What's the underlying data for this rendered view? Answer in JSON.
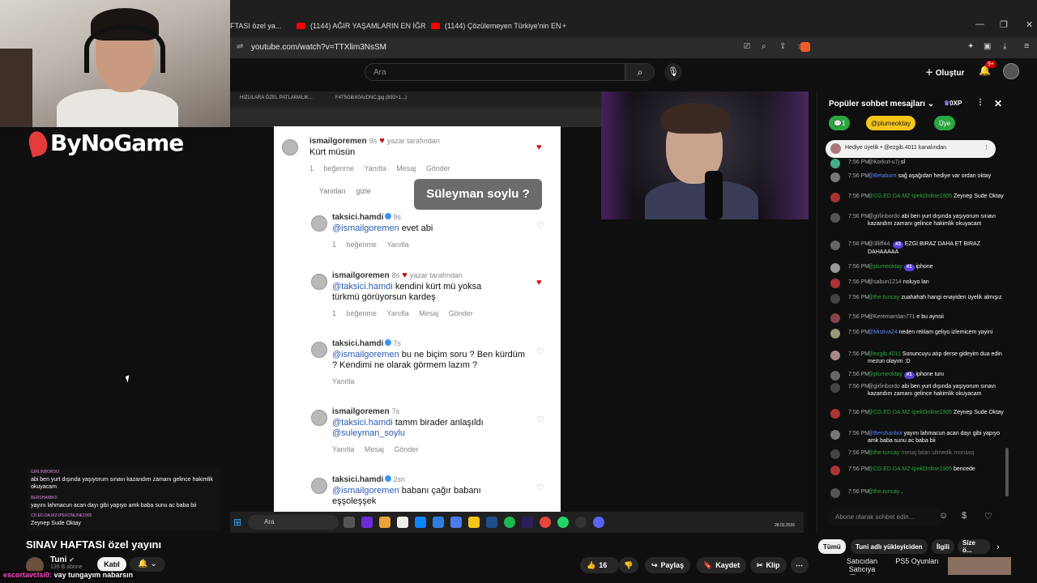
{
  "browser": {
    "tabs": [
      {
        "label": "FTASI özel ya..."
      },
      {
        "label": "(1144) AĞIR YAŞAMLARIN EN İĞREN..."
      },
      {
        "label": "(1144) Çözülemeyen Türkiye'nin EN..."
      }
    ],
    "new_tab": "+",
    "url": "youtube.com/watch?v=TTXlim3NsSM"
  },
  "yt_header": {
    "search_placeholder": "Ara",
    "create_label": "Oluştur",
    "notification_count": "9+"
  },
  "logo": {
    "text": "ByNoGame"
  },
  "inner_browser": {
    "tabs": [
      "HIZLILARA ÖZEL PATLAMALIK...",
      "F4T5GibX0AcDNC.jpg (892×1...)"
    ]
  },
  "phone": {
    "question_overlay": "Süleyman soylu ?",
    "comments": [
      {
        "user": "ismailgoremen",
        "time": "9s",
        "author_tag": "yazar tarafından",
        "body": "Kürt müsün",
        "actions": "1 beğenme   Yanıtla   Mesaj Gönder",
        "hide_replies": "Yanıtları gizle"
      },
      {
        "user": "taksici.hamdi",
        "time": "9s",
        "mention": "@ismailgoremen",
        "body": "evet abi",
        "actions": "1 beğenme   Yanıtla"
      },
      {
        "user": "ismailgoremen",
        "time": "8s",
        "author_tag": "yazar tarafından",
        "mention": "@taksici.hamdi",
        "body": "kendini kürt mü yoksa türkmü  görüyorsun kardeş",
        "actions": "1 beğenme   Yanıtla   Mesaj Gönder"
      },
      {
        "user": "taksici.hamdi",
        "time": "7s",
        "mention": "@ismailgoremen",
        "body": "bu ne biçim soru ? Ben kürdüm ? Kendimi ne olarak görmem lazım ?",
        "actions": "Yanıtla"
      },
      {
        "user": "ismailgoremen",
        "time": "7s",
        "mention": "@taksici.hamdi",
        "body": "tamm birader anlaşıldı",
        "mention2": "@suleyman_soylu",
        "actions": "Yanıtla   Mesaj Gönder"
      },
      {
        "user": "taksici.hamdi",
        "time": "2sn",
        "mention": "@ismailgoremen",
        "body": "babanı çağır babanı eşşoleşşek"
      }
    ]
  },
  "overlay_chat": [
    {
      "name": "GIRLINBORDO",
      "text": "abi ben yurt dışında yaşıyorum sınavı kazandım zamanı gelince hakimlik okuyacam"
    },
    {
      "name": "BERSHANBOI",
      "text": "yayını lahmacun acan dayı gibi yapıyo amk baba sunu ac baba bii"
    },
    {
      "name": "CD.ED.DA.MZ-IPEKONLINE1905",
      "text": "Zeynep Sude Oktay"
    }
  ],
  "taskbar": {
    "search": "Ara",
    "date": "28.03.2026"
  },
  "video": {
    "title": "SINAV HAFTASI özel yayını",
    "channel": "Tuni",
    "subscribers": "139 B abone",
    "join": "Katıl",
    "likes": "16",
    "share": "Paylaş",
    "save": "Kaydet",
    "clip": "Klip",
    "overlay_user": "escortavcisi0:",
    "overlay_text": "vay tungayım nabarsın"
  },
  "chat": {
    "header": "Popüler sohbet mesajları",
    "points": "0XP",
    "chips": [
      "1",
      "@plumeoktay",
      "Üye"
    ],
    "gift_banner": "Hediye üyelik • @ezgib.4011 kanalından",
    "messages": [
      {
        "time": "7:56 PM",
        "user": "@Korkut-u7j",
        "text": "sl",
        "type": "normal"
      },
      {
        "time": "7:56 PM",
        "user": "@Betaburn",
        "text": "sağ aşağıdan hediye var ordan oktay",
        "type": "mod"
      },
      {
        "time": "7:56 PM",
        "user": "@CD.ED.DA.MZ-IpekOnline1905",
        "text": "Zeynep Sude Oktay",
        "type": "mem"
      },
      {
        "time": "7:56 PM",
        "user": "@girlinbordo",
        "text": "abi ben yurt dışında yaşıyorum sınavı kazandım zamanı gelince hakimlik okuyacam",
        "type": "normal"
      },
      {
        "time": "7:56 PM",
        "user": "@3lliff44.",
        "badge": "#3",
        "text": "EZGİ BIRAZ DAHA ET BIRAZ DAHAAAAA",
        "type": "normal"
      },
      {
        "time": "7:56 PM",
        "user": "@plumeoktay",
        "badge": "#1",
        "text": "iphone",
        "type": "mem"
      },
      {
        "time": "7:56 PM",
        "user": "@sabun1214",
        "text": "noluyo lan",
        "type": "normal"
      },
      {
        "time": "7:56 PM",
        "user": "@the.tuncay",
        "text": "zuahahah hangi enayiden üyelik almışız",
        "type": "mem"
      },
      {
        "time": "7:56 PM",
        "user": "@Keremarslan771",
        "text": "e bu aynsii",
        "type": "normal"
      },
      {
        "time": "7:56 PM",
        "user": "@Mistiva24",
        "text": "neden reklam geliyo izlemicem yayini",
        "type": "mod"
      },
      {
        "time": "7:56 PM",
        "user": "@ezgib.4011",
        "text": "Sonuncuyu atıp derse gideyim dua edin mezun olayım :D",
        "type": "mem"
      },
      {
        "time": "7:56 PM",
        "user": "@plumeoktay",
        "badge": "#1",
        "text": "iphone tunı",
        "type": "mem"
      },
      {
        "time": "7:56 PM",
        "user": "@girlinbordo",
        "text": "abi ben yurt dışında yaşıyorum sınavı kazandım zamanı gelince hakimlik okuyacam",
        "type": "normal"
      },
      {
        "time": "7:56 PM",
        "user": "@CD.ED.DA.MZ-IpekOnline1905",
        "text": "Zeynep Sude Oktay",
        "type": "mem"
      },
      {
        "time": "7:56 PM",
        "user": "@Bershanboi",
        "text": "yayını lahmacun acan dayı gibi yapıyo amk baba sunu ac baba bii",
        "type": "mod"
      },
      {
        "time": "7:56 PM",
        "user": "@the.tuncay",
        "text": "mesaj falan silmedik moruwq",
        "type": "mem"
      },
      {
        "time": "7:56 PM",
        "user": "@CD.ED.DA.MZ-IpekOnline1905",
        "text": "bencede",
        "type": "mem"
      },
      {
        "time": "7:56 PM",
        "user": "@the.tuncay",
        "text": ".",
        "type": "mem"
      }
    ],
    "input_placeholder": "Abone olarak sohbet edin..."
  },
  "related": {
    "tabs": [
      "Tümü",
      "Tuni adlı yükleyiciden",
      "İlgili",
      "Size ö..."
    ],
    "thumbs": [
      "Satıcıdan Satıcıya Ticaret!",
      "PS5 Oyunları"
    ]
  }
}
